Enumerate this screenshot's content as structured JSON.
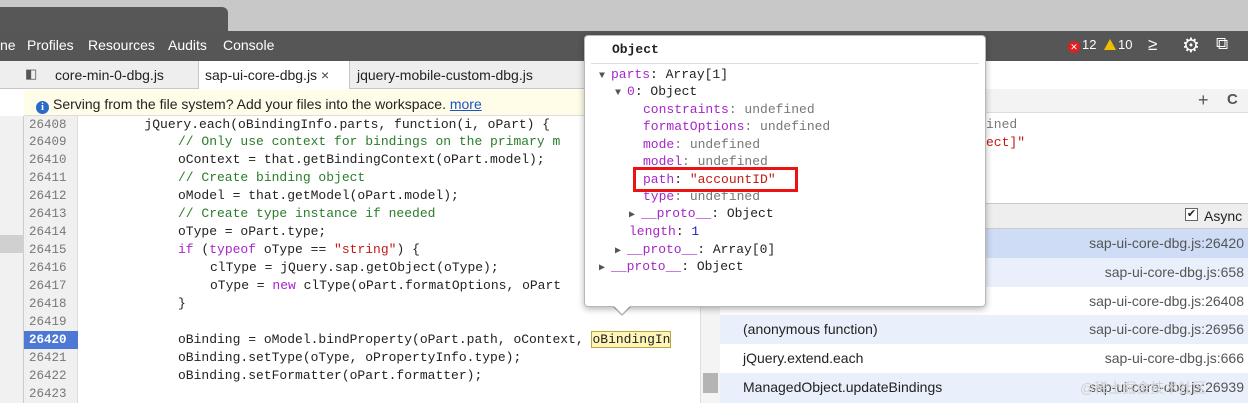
{
  "menubar": {
    "items": [
      "ne",
      "Profiles",
      "Resources",
      "Audits",
      "Console"
    ],
    "errors": "12",
    "warnings": "10"
  },
  "file_tabs": [
    "core-min-0-dbg.js",
    "sap-ui-core-dbg.js",
    "×",
    "jquery-mobile-custom-dbg.js"
  ],
  "infobar": {
    "message": "Serving from the file system? Add your files into the workspace.",
    "link": "more"
  },
  "code": {
    "line_numbers": [
      "26408",
      "26409",
      "26410",
      "26411",
      "26412",
      "26413",
      "26414",
      "26415",
      "26416",
      "26417",
      "26418",
      "26419",
      "26420",
      "26421",
      "26422",
      "26423"
    ],
    "selected_line": "26420",
    "l0": "        jQuery.each(oBindingInfo.parts, function(i, oPart) {",
    "l1": "// Only use context for bindings on the primary m",
    "l2": "oContext = that.getBindingContext(oPart.model);",
    "l3": "// Create binding object",
    "l4": "oModel = that.getModel(oPart.model);",
    "l5": "// Create type instance if needed",
    "l6": "oType = oPart.type;",
    "l7a": "if",
    "l7b": " (",
    "l7c": "typeof",
    "l7d": " oType == ",
    "l7e": "\"string\"",
    "l7f": ") {",
    "l8": "clType = jQuery.sap.getObject(oType);",
    "l9a": "oType = ",
    "l9b": "new",
    "l9c": " clType(oPart.formatOptions, oPart",
    "l10": "}",
    "l12a": "oBinding = oModel.bindProperty(oPart.path, oContext, ",
    "l12b": "oBindingIn",
    "l13": "oBinding.setType(oType, oPropertyInfo.type);",
    "l14": "oBinding.setFormatter(oPart.formatter);"
  },
  "popover": {
    "title": "Object",
    "parts_key": "parts",
    "parts_val": ": Array[1]",
    "idx_key": "0",
    "idx_val": ": Object",
    "constraints_key": "constraints",
    "formatOptions_key": "formatOptions",
    "mode_key": "mode",
    "model_key": "model",
    "path_key": "path",
    "path_val": "\"accountID\"",
    "type_key": "type",
    "undefined": ": undefined",
    "colon": ": ",
    "proto_key": "__proto__",
    "proto_obj": ": Object",
    "length_key": "length",
    "length_val": "1",
    "proto_arr": ": Array[0]"
  },
  "right_panel": {
    "add": "+",
    "refresh": "C",
    "partial1": "ined",
    "partial2": "ect]\"",
    "async_label": "Async",
    "async_checked": true,
    "stack": [
      {
        "fn": "",
        "loc": "sap-ui-core-dbg.js:26420"
      },
      {
        "fn": "",
        "loc": "sap-ui-core-dbg.js:658"
      },
      {
        "fn": "",
        "loc": "sap-ui-core-dbg.js:26408"
      },
      {
        "fn": "(anonymous function)",
        "loc": "sap-ui-core-dbg.js:26956"
      },
      {
        "fn": "jQuery.extend.each",
        "loc": "sap-ui-core-dbg.js:666"
      },
      {
        "fn": "ManagedObject.updateBindings",
        "loc": "sap-ui-core-dbg.js:26939"
      }
    ]
  },
  "watermark": "@稀土掘金技术社区",
  "colors": {
    "menubar": "#565656",
    "selected_line": "#4e78d6",
    "highlight_box": "#e11111",
    "property": "#a626c8",
    "string": "#c41a16"
  }
}
